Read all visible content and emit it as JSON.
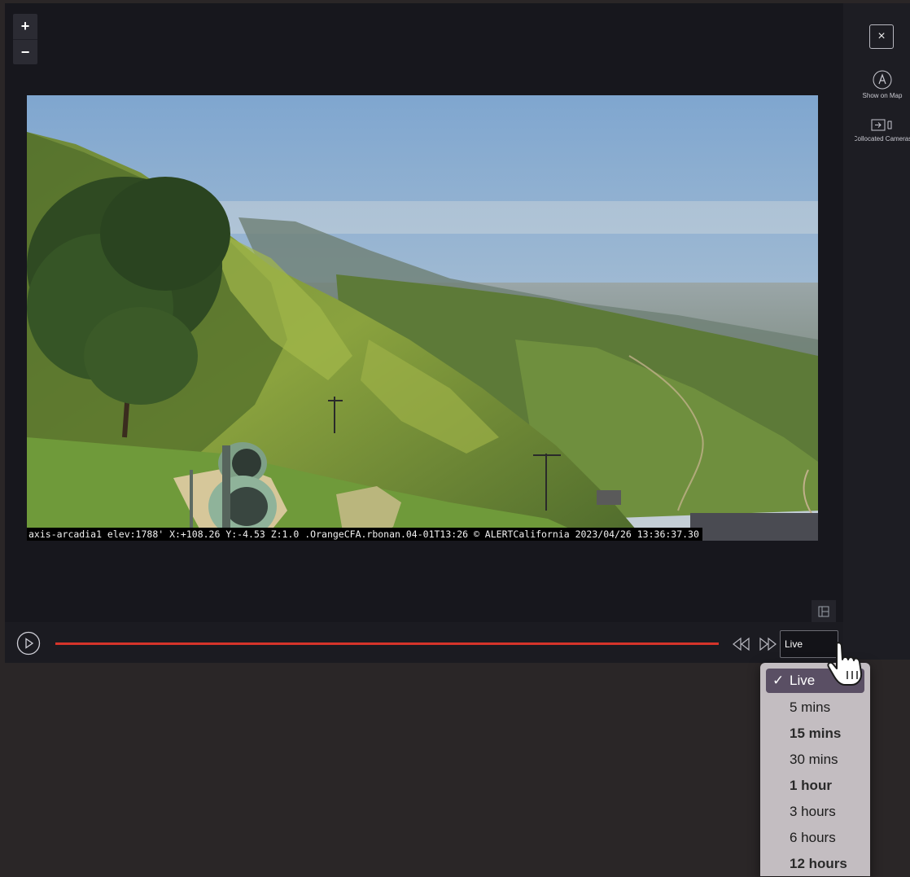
{
  "zoom": {
    "in_label": "+",
    "out_label": "−"
  },
  "camera": {
    "overlay_text": "axis-arcadia1 elev:1788' X:+108.26 Y:-4.53 Z:1.0 .OrangeCFA.rbonan.04-01T13:26 © ALERTCalifornia 2023/04/26 13:36:37.30"
  },
  "side_panel": {
    "close_label": "×",
    "show_on_map_label": "Show on Map",
    "collocated_label": "Collocated Cameras"
  },
  "player": {
    "selected_range": "Live"
  },
  "dropdown": {
    "options": [
      {
        "label": "Live",
        "selected": true,
        "check": "✓"
      },
      {
        "label": "5 mins"
      },
      {
        "label": "15 mins",
        "strong": true
      },
      {
        "label": "30 mins"
      },
      {
        "label": "1 hour",
        "strong": true
      },
      {
        "label": "3 hours"
      },
      {
        "label": "6 hours"
      },
      {
        "label": "12 hours",
        "strong": true
      }
    ]
  },
  "icons": {
    "zoom_in": "plus-icon",
    "zoom_out": "minus-icon",
    "close": "close-icon",
    "show_on_map": "map-pin-icon",
    "collocated": "camera-switch-icon",
    "play": "play-icon",
    "rewind": "rewind-icon",
    "fast_forward": "fast-forward-icon",
    "fullscreen": "fullscreen-icon"
  },
  "colors": {
    "timeline": "#d6342a",
    "dropdown_bg": "#c3bdc1",
    "dropdown_selected": "#5a4f64"
  }
}
